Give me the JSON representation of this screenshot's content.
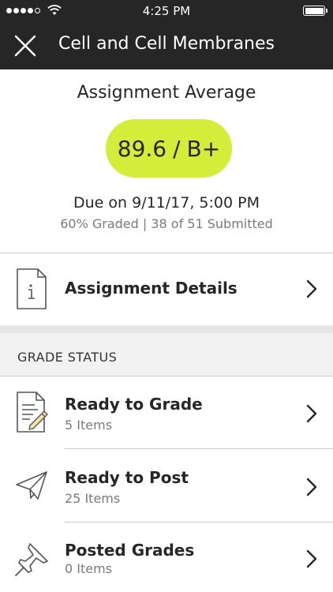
{
  "status_bar": {
    "time": "4:25 PM"
  },
  "header": {
    "title": "Cell and Cell Membranes"
  },
  "summary": {
    "heading": "Assignment Average",
    "score": "89.6",
    "separator": "/",
    "letter": "B+",
    "pill_color": "#d4ec3a",
    "due": "Due on 9/11/17, 5:00 PM",
    "progress": "60% Graded | 38 of 51 Submitted"
  },
  "details": {
    "label": "Assignment Details",
    "icon": "document-info-icon"
  },
  "grade_status": {
    "title": "GRADE STATUS",
    "items": [
      {
        "label": "Ready to Grade",
        "count": "5 Items",
        "icon": "document-pencil-icon"
      },
      {
        "label": "Ready to Post",
        "count": "25 Items",
        "icon": "paper-plane-icon"
      },
      {
        "label": "Posted Grades",
        "count": "0 Items",
        "icon": "pushpin-icon"
      }
    ]
  },
  "colors": {
    "bar": "#262626",
    "accent": "#d4ec3a",
    "section_bg": "#f2f2f2"
  }
}
